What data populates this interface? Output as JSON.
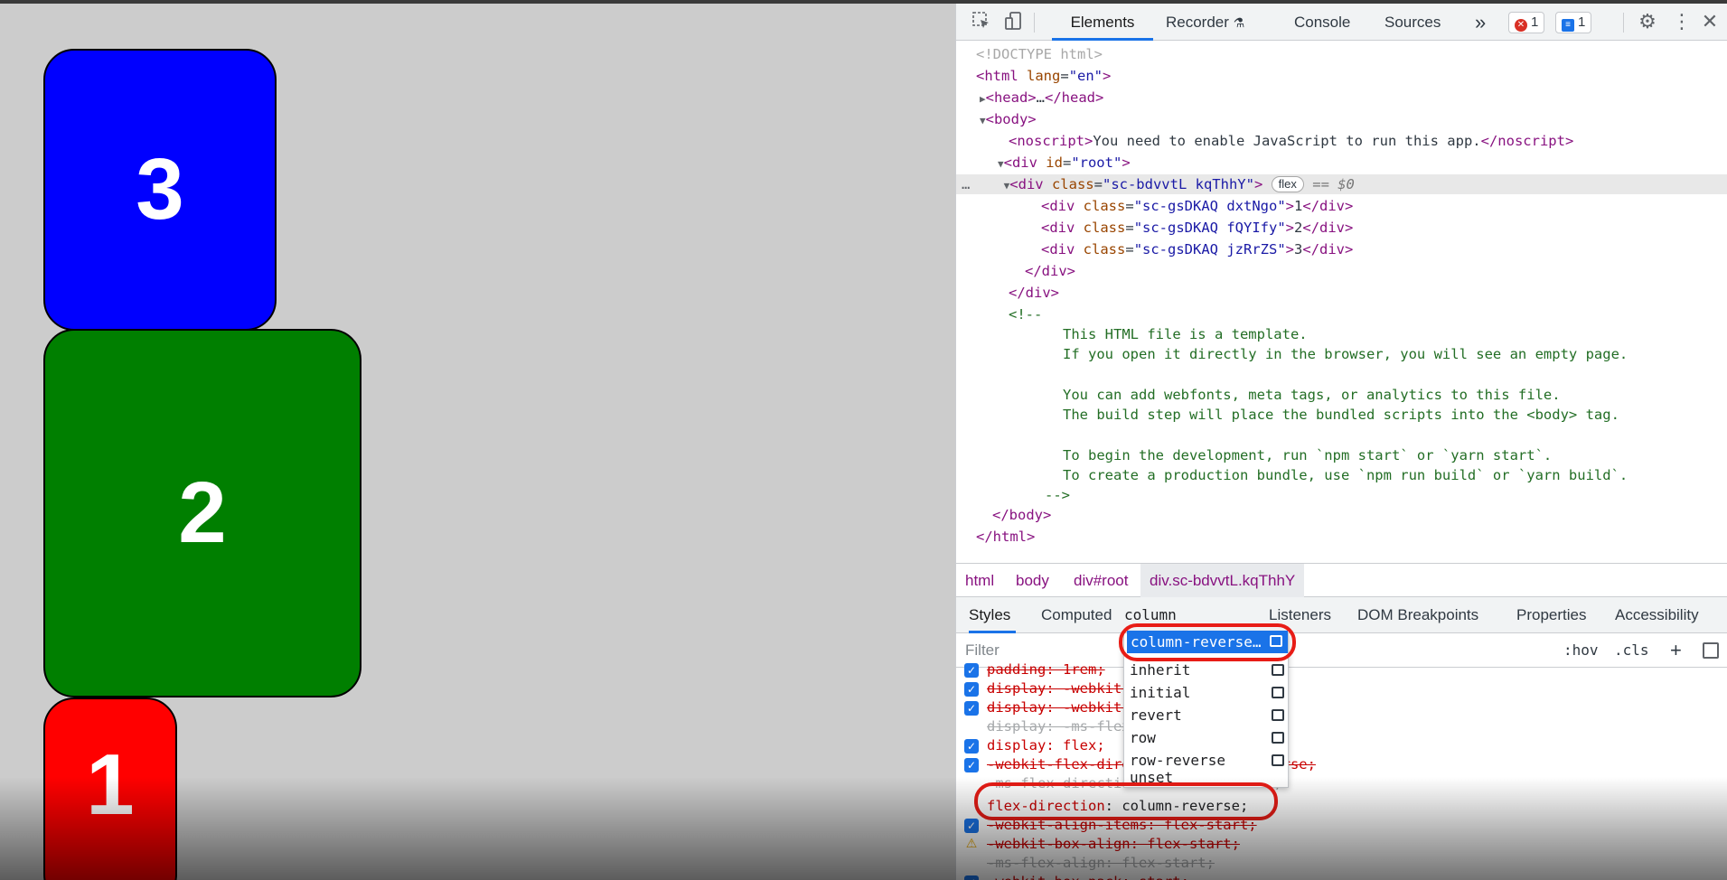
{
  "page_boxes": [
    {
      "label": "3",
      "color": "#0000ff"
    },
    {
      "label": "2",
      "color": "#007f00"
    },
    {
      "label": "1",
      "color": "#ff0000"
    }
  ],
  "devtools": {
    "tabs": [
      "Elements",
      "Recorder",
      "Console",
      "Sources"
    ],
    "more": "»",
    "error_count": "1",
    "message_count": "1",
    "dom": {
      "doctype": "<!DOCTYPE html>",
      "html_open_tag": "html",
      "html_attr": "lang",
      "html_attr_val": "\"en\"",
      "head": "head",
      "head_ellipsis": "…",
      "body": "body",
      "noscript": "noscript",
      "noscript_text": "You need to enable JavaScript to run this app.",
      "root_attr": "id",
      "root_val": "\"root\"",
      "container_class": "\"sc-bdvvtL kqThhY\"",
      "flex_pill": "flex",
      "eq_sign": "== $0",
      "child1_class": "\"sc-gsDKAQ dxtNgo\"",
      "child1_text": "1",
      "child2_class": "\"sc-gsDKAQ fQYIfy\"",
      "child2_text": "2",
      "child3_class": "\"sc-gsDKAQ jzRrZS\"",
      "child3_text": "3",
      "comment_open": "<!--",
      "comment_lines": [
        "This HTML file is a template.",
        "If you open it directly in the browser, you will see an empty page.",
        "",
        "You can add webfonts, meta tags, or analytics to this file.",
        "The build step will place the bundled scripts into the <body> tag.",
        "",
        "To begin the development, run `npm start` or `yarn start`.",
        "To create a production bundle, use `npm run build` or `yarn build`."
      ],
      "comment_close": "-->"
    },
    "breadcrumbs": [
      "html",
      "body",
      "div#root",
      "div.sc-bdvvtL.kqThhY"
    ],
    "styles_tabs": [
      "Styles",
      "Computed",
      "Listeners",
      "DOM Breakpoints",
      "Properties",
      "Accessibility"
    ],
    "filter_placeholder": "Filter",
    "hov": ":hov",
    "cls": ".cls",
    "plus": "+",
    "editing_value": "column",
    "autocomplete": {
      "selected": "column-reverse…",
      "items": [
        "inherit",
        "initial",
        "revert",
        "row",
        "row-reverse",
        "unset"
      ]
    },
    "rules": [
      {
        "text": "padding: 1rem;",
        "struck": true
      },
      {
        "text": "display: -webkit-box;",
        "struck": true
      },
      {
        "text": "display: -webkit-flex;",
        "struck": true
      },
      {
        "text": "display: -ms-flexbox;",
        "struck": true
      },
      {
        "text": "display: flex;",
        "struck": false
      },
      {
        "text": "-webkit-flex-direction: column-reverse;",
        "struck": true
      },
      {
        "text": "-ms-flex-direction: column-reverse;",
        "struck": true
      },
      {
        "prop": "flex-direction",
        "value": "column-reverse;"
      },
      {
        "text": "-webkit-align-items: flex-start;",
        "struck": true
      },
      {
        "text": "-webkit-box-align: flex-start;",
        "struck": true
      },
      {
        "text": "-ms-flex-align: flex-start;",
        "struck": true
      },
      {
        "text": "-webkit-box-pack: start;",
        "struck": true
      }
    ]
  }
}
